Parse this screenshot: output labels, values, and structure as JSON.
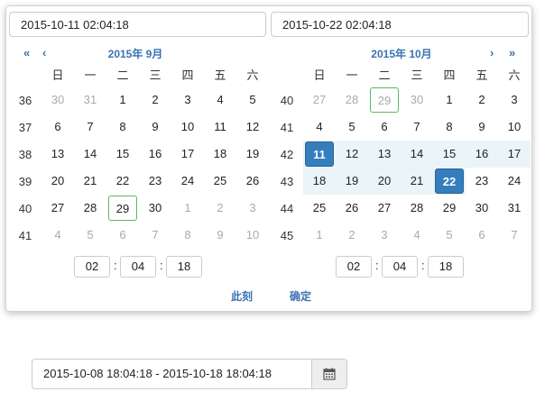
{
  "range": {
    "start_value": "2015-10-11 02:04:18",
    "end_value": "2015-10-22 02:04:18"
  },
  "nav": {
    "prev_year": "«",
    "prev_month": "‹",
    "next_month": "›",
    "next_year": "»"
  },
  "weekdays": [
    "日",
    "一",
    "二",
    "三",
    "四",
    "五",
    "六"
  ],
  "left_calendar": {
    "title": "2015年  9月",
    "weeks": [
      {
        "wk": "36",
        "days": [
          "30",
          "31",
          "1",
          "2",
          "3",
          "4",
          "5"
        ]
      },
      {
        "wk": "37",
        "days": [
          "6",
          "7",
          "8",
          "9",
          "10",
          "11",
          "12"
        ]
      },
      {
        "wk": "38",
        "days": [
          "13",
          "14",
          "15",
          "16",
          "17",
          "18",
          "19"
        ]
      },
      {
        "wk": "39",
        "days": [
          "20",
          "21",
          "22",
          "23",
          "24",
          "25",
          "26"
        ]
      },
      {
        "wk": "40",
        "days": [
          "27",
          "28",
          "29",
          "30",
          "1",
          "2",
          "3"
        ]
      },
      {
        "wk": "41",
        "days": [
          "4",
          "5",
          "6",
          "7",
          "8",
          "9",
          "10"
        ]
      }
    ],
    "time": {
      "hour": "02",
      "minute": "04",
      "second": "18"
    }
  },
  "right_calendar": {
    "title": "2015年  10月",
    "weeks": [
      {
        "wk": "40",
        "days": [
          "27",
          "28",
          "29",
          "30",
          "1",
          "2",
          "3"
        ]
      },
      {
        "wk": "41",
        "days": [
          "4",
          "5",
          "6",
          "7",
          "8",
          "9",
          "10"
        ]
      },
      {
        "wk": "42",
        "days": [
          "11",
          "12",
          "13",
          "14",
          "15",
          "16",
          "17"
        ]
      },
      {
        "wk": "43",
        "days": [
          "18",
          "19",
          "20",
          "21",
          "22",
          "23",
          "24"
        ]
      },
      {
        "wk": "44",
        "days": [
          "25",
          "26",
          "27",
          "28",
          "29",
          "30",
          "31"
        ]
      },
      {
        "wk": "45",
        "days": [
          "1",
          "2",
          "3",
          "4",
          "5",
          "6",
          "7"
        ]
      }
    ],
    "time": {
      "hour": "02",
      "minute": "04",
      "second": "18"
    }
  },
  "actions": {
    "now_label": "此刻",
    "confirm_label": "确定"
  },
  "main_input": {
    "value": "2015-10-08 18:04:18 - 2015-10-18 18:04:18"
  },
  "icons": {
    "calendar_button": "calendar-icon"
  },
  "colors": {
    "accent": "#3b73b0",
    "selected": "#357ebd",
    "in_range": "#ebf4f8",
    "today_border": "#5cb85c",
    "muted_text": "#aaaaaa"
  }
}
